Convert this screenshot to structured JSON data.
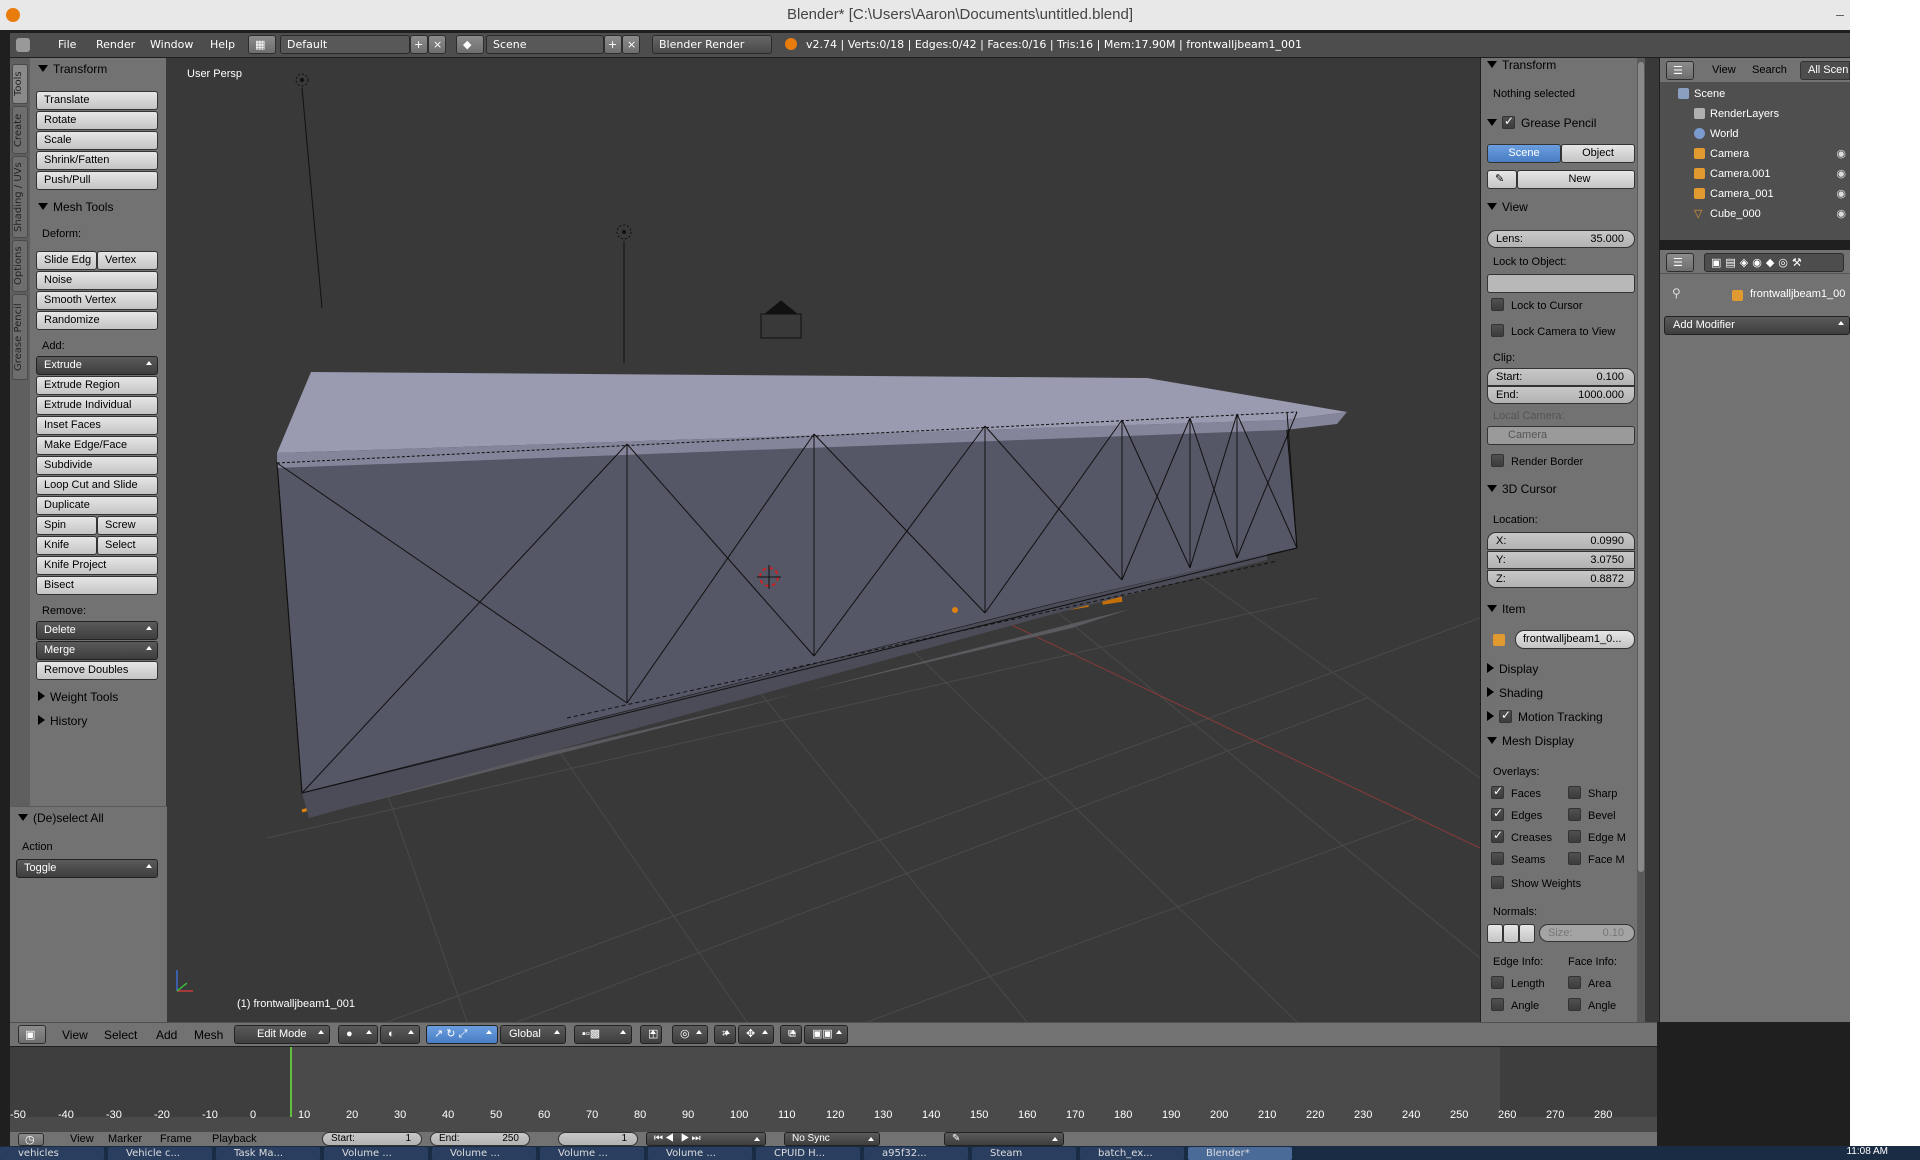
{
  "window": {
    "title": "Blender* [C:\\Users\\Aaron\\Documents\\untitled.blend]"
  },
  "menubar": {
    "items": [
      "File",
      "Render",
      "Window",
      "Help"
    ],
    "layout": "Default",
    "scene": "Scene",
    "engine": "Blender Render",
    "stats": "v2.74 | Verts:0/18 | Edges:0/42 | Faces:0/16 | Tris:16 | Mem:17.90M | frontwalljbeam1_001"
  },
  "lefttabs": [
    "Tools",
    "Create",
    "Shading / UVs",
    "Options",
    "Grease Pencil"
  ],
  "tools": {
    "transform_title": "Transform",
    "transform": [
      "Translate",
      "Rotate",
      "Scale",
      "Shrink/Fatten",
      "Push/Pull"
    ],
    "meshtools_title": "Mesh Tools",
    "deform_label": "Deform:",
    "slide_edge": "Slide Edg",
    "vertex": "Vertex",
    "deform": [
      "Noise",
      "Smooth Vertex",
      "Randomize"
    ],
    "add_label": "Add:",
    "extrude": "Extrude",
    "add": [
      "Extrude Region",
      "Extrude Individual",
      "Inset Faces",
      "Make Edge/Face",
      "Subdivide",
      "Loop Cut and Slide",
      "Duplicate"
    ],
    "spin": "Spin",
    "screw": "Screw",
    "knife": "Knife",
    "select": "Select",
    "add2": [
      "Knife Project",
      "Bisect"
    ],
    "remove_label": "Remove:",
    "delete": "Delete",
    "merge": "Merge",
    "remove_doubles": "Remove Doubles",
    "weight_tools": "Weight Tools",
    "history": "History",
    "op_title": "(De)select All",
    "action_label": "Action",
    "action_value": "Toggle"
  },
  "viewport": {
    "persp": "User Persp",
    "object_label": "(1) frontwalljbeam1_001"
  },
  "npanel": {
    "transform_title": "Transform",
    "nothing_selected": "Nothing selected",
    "grease_pencil": "Grease Pencil",
    "gp_scene": "Scene",
    "gp_object": "Object",
    "gp_new": "New",
    "view_title": "View",
    "lens_label": "Lens:",
    "lens_value": "35.000",
    "lock_to_object": "Lock to Object:",
    "lock_to_cursor": "Lock to Cursor",
    "lock_camera": "Lock Camera to View",
    "clip": "Clip:",
    "start_label": "Start:",
    "start_value": "0.100",
    "end_label": "End:",
    "end_value": "1000.000",
    "local_camera": "Local Camera:",
    "camera_placeholder": "Camera",
    "render_border": "Render Border",
    "cursor_title": "3D Cursor",
    "location": "Location:",
    "x_label": "X:",
    "x_value": "0.0990",
    "y_label": "Y:",
    "y_value": "3.0750",
    "z_label": "Z:",
    "z_value": "0.8872",
    "item_title": "Item",
    "item_name": "frontwalljbeam1_0...",
    "display": "Display",
    "shading": "Shading",
    "motion_tracking": "Motion Tracking",
    "mesh_display": "Mesh Display",
    "overlays": "Overlays:",
    "faces": "Faces",
    "sharp": "Sharp",
    "edges": "Edges",
    "bevel": "Bevel",
    "creases": "Creases",
    "edge_m": "Edge M",
    "seams": "Seams",
    "face_m": "Face M",
    "show_weights": "Show Weights",
    "normals": "Normals:",
    "size": "Size:",
    "size_value": "0.10",
    "edge_info": "Edge Info:",
    "face_info": "Face Info:",
    "length": "Length",
    "area": "Area",
    "angle1": "Angle",
    "angle2": "Angle"
  },
  "outliner": {
    "view": "View",
    "search": "Search",
    "all_scenes": "All Scen",
    "rows": [
      "Scene",
      "RenderLayers",
      "World",
      "Camera",
      "Camera.001",
      "Camera_001",
      "Cube_000"
    ]
  },
  "properties": {
    "object_name": "frontwalljbeam1_00",
    "add_modifier": "Add Modifier"
  },
  "vpheader": {
    "view": "View",
    "select": "Select",
    "add": "Add",
    "mesh": "Mesh",
    "mode": "Edit Mode",
    "orientation": "Global"
  },
  "timeline": {
    "ticks": [
      "-50",
      "-40",
      "-30",
      "-20",
      "-10",
      "0",
      "10",
      "20",
      "30",
      "40",
      "50",
      "60",
      "70",
      "80",
      "90",
      "100",
      "110",
      "120",
      "130",
      "140",
      "150",
      "160",
      "170",
      "180",
      "190",
      "200",
      "210",
      "220",
      "230",
      "240",
      "250",
      "260",
      "270",
      "280"
    ],
    "view": "View",
    "marker": "Marker",
    "frame": "Frame",
    "playback": "Playback",
    "start": "Start:",
    "start_v": "1",
    "end": "End:",
    "end_v": "250",
    "current": "1",
    "nosync": "No Sync"
  },
  "taskbar": {
    "items": [
      "vehicles",
      "Vehicle c...",
      "Task Ma...",
      "Volume ...",
      "Volume ...",
      "Volume ...",
      "Volume ...",
      "CPUID H...",
      "a95f32...",
      "Steam",
      "batch_ex...",
      "Blender*"
    ],
    "clock": "11:08 AM"
  }
}
